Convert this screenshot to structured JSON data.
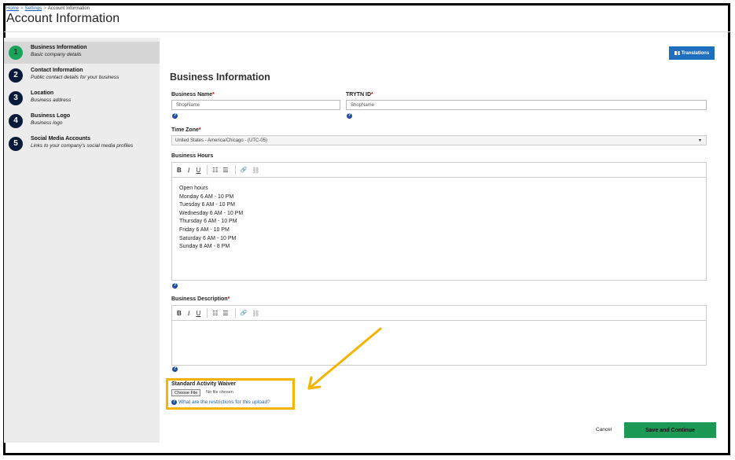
{
  "breadcrumb": {
    "home": "Home",
    "settings": "Settings",
    "current": "Account Information",
    "sep": ">"
  },
  "page_title": "Account Information",
  "sidebar": {
    "steps": [
      {
        "num": "1",
        "title": "Business Information",
        "subtitle": "Basic company details"
      },
      {
        "num": "2",
        "title": "Contact Information",
        "subtitle": "Public contact details for your business"
      },
      {
        "num": "3",
        "title": "Location",
        "subtitle": "Business address"
      },
      {
        "num": "4",
        "title": "Business Logo",
        "subtitle": "Business logo"
      },
      {
        "num": "5",
        "title": "Social Media Accounts",
        "subtitle": "Links to your company's social media profiles"
      }
    ]
  },
  "translations_button": {
    "icon": "translate-icon",
    "label": "Translations"
  },
  "section_title": "Business Information",
  "fields": {
    "business_name": {
      "label": "Business Name",
      "required": "*",
      "value": "ShopName"
    },
    "trytn_id": {
      "label": "TRYTN ID",
      "required": "*",
      "value": "ShopName"
    },
    "time_zone": {
      "label": "Time Zone",
      "required": "*",
      "value": "United States - America/Chicago - (UTC-05)"
    },
    "business_hours": {
      "label": "Business Hours",
      "lines": [
        "Open hours",
        "Monday 6 AM - 10 PM",
        "Tuesday 6 AM - 10 PM",
        "Wednesday 6 AM - 10 PM",
        "Thursday 6 AM - 10 PM",
        "Friday 6 AM - 10 PM",
        "Saturday 6 AM - 10 PM",
        "Sunday 8 AM - 8 PM"
      ]
    },
    "business_description": {
      "label": "Business Description",
      "required": "*"
    },
    "waiver": {
      "label": "Standard Activity Waiver",
      "button": "Choose File",
      "file_status": "No file chosen",
      "help_link": "What are the restrictions for this upload?"
    }
  },
  "toolbar": {
    "bold": "B",
    "italic": "I",
    "underline": "U",
    "bullets": "☷",
    "numbered": "☰",
    "link": "🔗",
    "unlink": "⛓"
  },
  "help_glyph": "?",
  "caret": "▾",
  "footer": {
    "cancel": "Cancel",
    "save": "Save and Continue"
  },
  "colors": {
    "accent_green": "#1c9a55",
    "primary_blue": "#1f6fbf",
    "highlight": "#f5b400",
    "step_dark": "#0a1a3a"
  }
}
